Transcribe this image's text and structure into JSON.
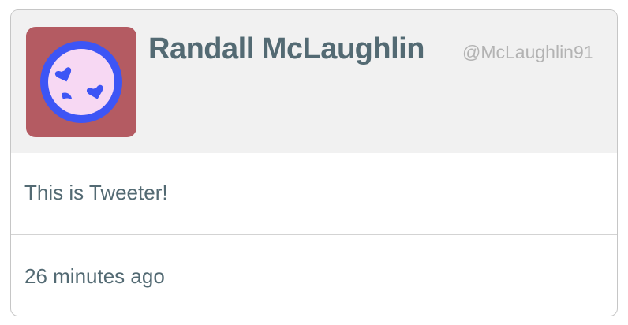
{
  "tweet": {
    "author_name": "Randall McLaughlin",
    "author_handle": "@McLaughlin91",
    "message": "This is Tweeter!",
    "timestamp": "26 minutes ago"
  },
  "avatar": {
    "icon": "heart-moons-avatar-icon",
    "background_color": "#b45b62",
    "ring_color": "#3d55f5",
    "face_color": "#f7d8f3"
  }
}
